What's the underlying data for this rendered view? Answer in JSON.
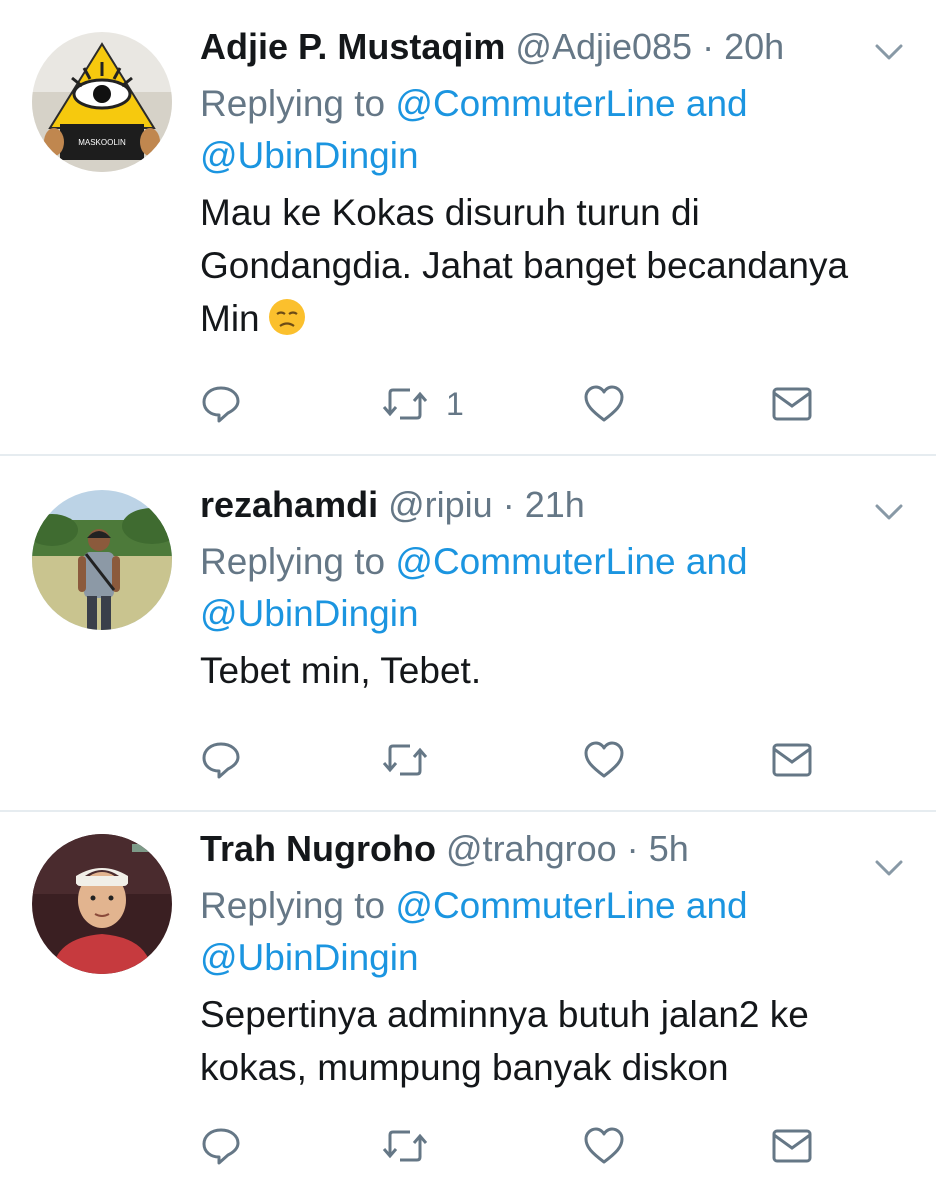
{
  "tweets": [
    {
      "name": "Adjie P. Mustaqim",
      "handle": "@Adjie085",
      "separator": "·",
      "time": "20h",
      "replying_prefix": "Replying to",
      "mention1": "@CommuterLine",
      "and": "and",
      "mention2": "@UbinDingin",
      "text": "Mau ke Kokas disuruh turun di Gondangdia. Jahat banget becandanya Min",
      "emoji": "disappointed-face-emoji",
      "avatar_text": "MASKOOLIN",
      "retweet_count": "1"
    },
    {
      "name": "rezahamdi",
      "handle": "@ripiu",
      "separator": "·",
      "time": "21h",
      "replying_prefix": "Replying to",
      "mention1": "@CommuterLine",
      "and": "and",
      "mention2": "@UbinDingin",
      "text": "Tebet min, Tebet."
    },
    {
      "name": "Trah Nugroho",
      "handle": "@trahgroo",
      "separator": "·",
      "time": "5h",
      "replying_prefix": "Replying to",
      "mention1": "@CommuterLine",
      "and": "and",
      "mention2": "@UbinDingin",
      "text": "Sepertinya adminnya butuh jalan2 ke kokas, mumpung banyak diskon"
    }
  ],
  "icons": {
    "reply": "reply-icon",
    "retweet": "retweet-icon",
    "like": "heart-icon",
    "dm": "direct-message-icon",
    "caret": "chevron-down-icon"
  },
  "colors": {
    "mention": "#1b95e0",
    "secondary_text": "#657786",
    "primary_text": "#14171a",
    "divider": "#e6ecf0"
  }
}
